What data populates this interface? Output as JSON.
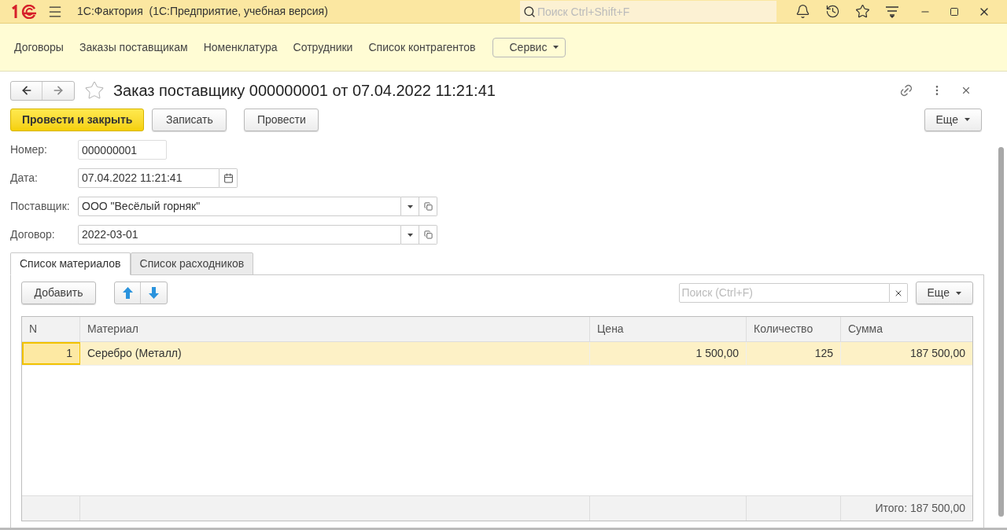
{
  "app": {
    "title": "1С:Фактория  (1С:Предприятие, учебная версия)",
    "search": {
      "placeholder": "Поиск Ctrl+Shift+F"
    }
  },
  "nav": {
    "items": [
      "Договоры",
      "Заказы поставщикам",
      "Номенклатура",
      "Сотрудники",
      "Список контрагентов"
    ],
    "menu": "Сервис"
  },
  "document": {
    "title": "Заказ поставщику 000000001 от 07.04.2022 11:21:41",
    "favorite": false,
    "buttons": [
      {
        "label": "Провести и закрыть",
        "kind": "primary"
      },
      {
        "label": "Записать",
        "kind": "default"
      },
      {
        "label": "Провести",
        "kind": "default"
      }
    ],
    "more": "Еще",
    "fields": [
      {
        "label": "Номер:",
        "value": "000000001",
        "kind": "plain"
      },
      {
        "label": "Дата:",
        "value": "07.04.2022 11:21:41",
        "kind": "date"
      },
      {
        "label": "Поставщик:",
        "value": "ООО \"Весёлый горняк\"",
        "kind": "select"
      },
      {
        "label": "Договор:",
        "value": "2022-03-01",
        "kind": "select"
      }
    ],
    "tabs": [
      {
        "label": "Список материалов",
        "selected": true
      },
      {
        "label": "Список расходников",
        "selected": false
      }
    ],
    "table_toolbar": {
      "add": "Добавить",
      "search": {
        "placeholder": "Поиск (Ctrl+F)"
      },
      "more": "Еще"
    },
    "table": {
      "columns": [
        {
          "label": "N",
          "kind": "number"
        },
        {
          "label": "Материал",
          "kind": "text"
        },
        {
          "label": "Цена",
          "kind": "number"
        },
        {
          "label": "Количество",
          "kind": "number"
        },
        {
          "label": "Сумма",
          "kind": "number"
        }
      ],
      "rows": [
        {
          "selected": true,
          "cells": [
            "1",
            "Серебро (Металл)",
            "1 500,00",
            "125",
            "187 500,00"
          ]
        }
      ],
      "total": "Итого: 187 500,00"
    }
  }
}
